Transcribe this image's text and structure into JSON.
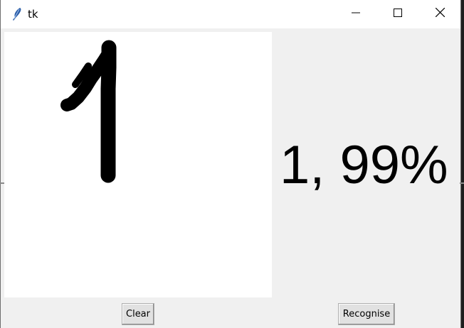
{
  "window": {
    "title": "tk",
    "controls": {
      "minimize_icon": "minimize-icon",
      "maximize_icon": "maximize-icon",
      "close_icon": "close-icon"
    },
    "app_icon": "feather-icon"
  },
  "canvas": {
    "background": "#ffffff",
    "stroke_color": "#000000"
  },
  "result": {
    "text": "1, 99%"
  },
  "buttons": {
    "clear_label": "Clear",
    "recognise_label": "Recognise"
  }
}
